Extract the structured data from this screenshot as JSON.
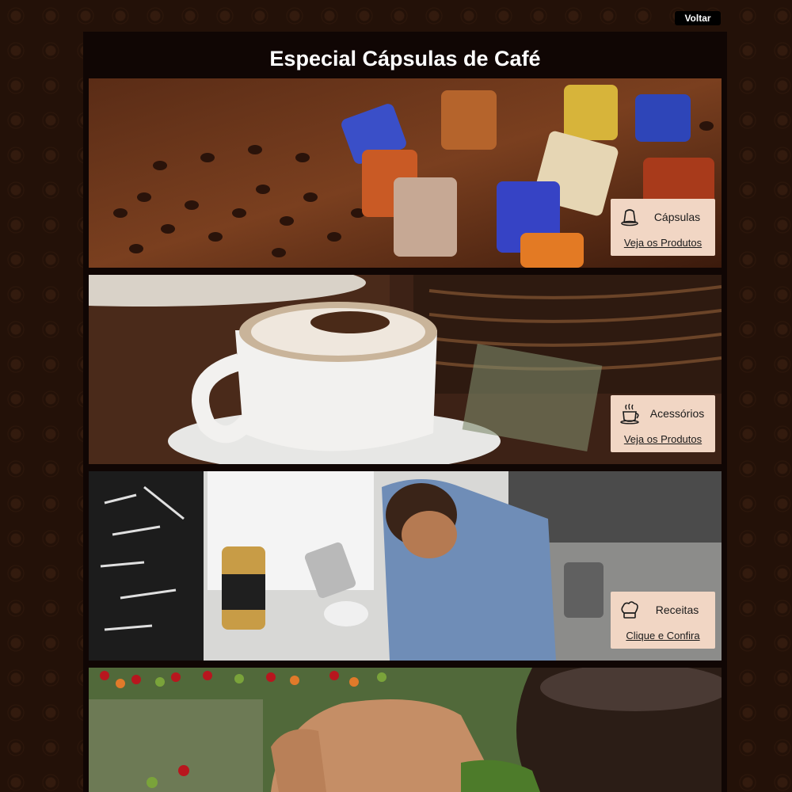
{
  "header": {
    "back_label": "Voltar"
  },
  "page": {
    "title": "Especial Cápsulas de Café"
  },
  "sections": [
    {
      "title": "Cápsulas",
      "link": "Veja os Produtos",
      "icon": "capsule-icon"
    },
    {
      "title": "Acessórios",
      "link": "Veja os Produtos",
      "icon": "coffee-cup-icon"
    },
    {
      "title": "Receitas",
      "link": "Clique e Confira",
      "icon": "chef-hat-icon"
    }
  ],
  "colors": {
    "background": "#231108",
    "container": "#100604",
    "card": "#f1d6c4",
    "back_button": "#000000"
  }
}
